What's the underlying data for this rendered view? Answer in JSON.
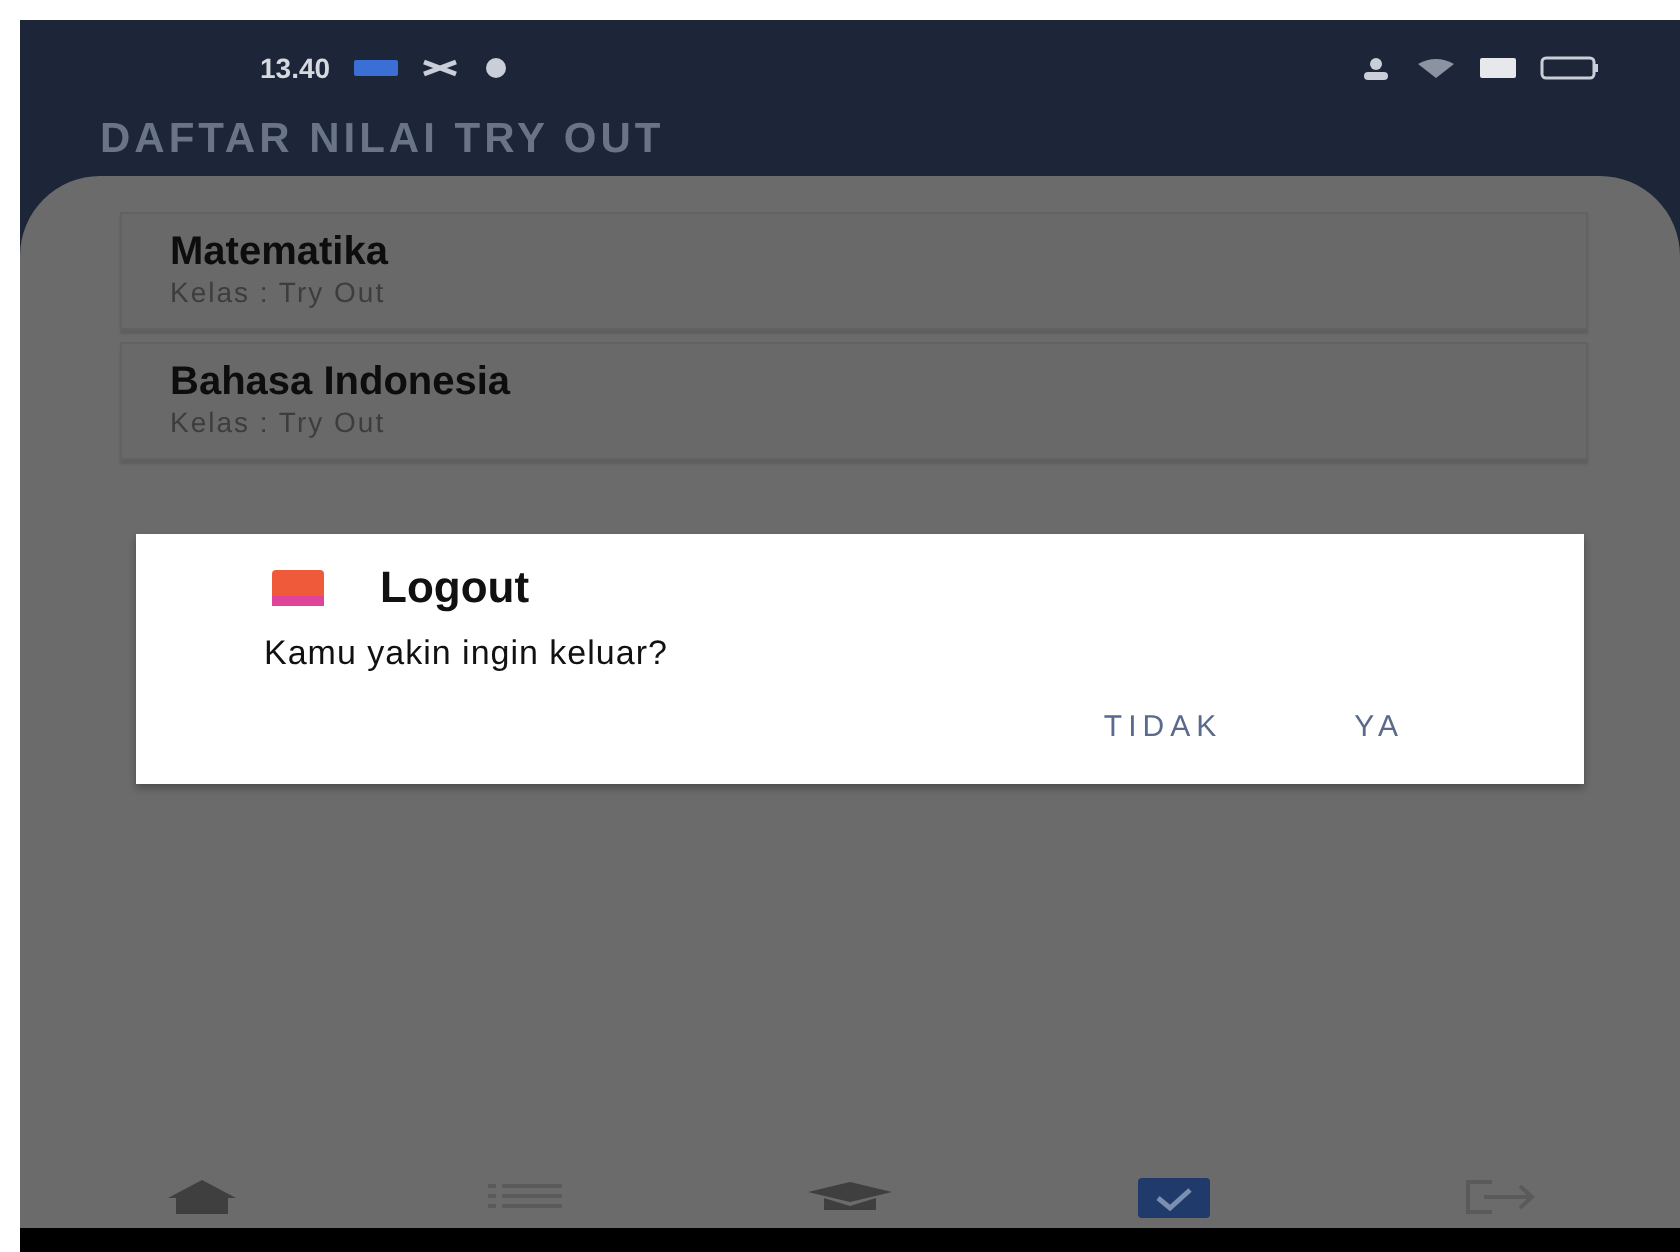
{
  "status_bar": {
    "time": "13.40"
  },
  "header": {
    "title": "DAFTAR NILAI TRY OUT"
  },
  "subjects": [
    {
      "name": "Matematika",
      "class": "Kelas : Try Out"
    },
    {
      "name": "Bahasa Indonesia",
      "class": "Kelas : Try Out"
    }
  ],
  "dialog": {
    "title": "Logout",
    "message": "Kamu yakin ingin keluar?",
    "buttons": [
      "TIDAK",
      "YA"
    ]
  },
  "bottom_nav": [
    {
      "kind": "home",
      "selected": false
    },
    {
      "kind": "list",
      "selected": false
    },
    {
      "kind": "cap",
      "selected": false
    },
    {
      "kind": "clipboard",
      "selected": true
    },
    {
      "kind": "logout",
      "selected": false
    }
  ]
}
